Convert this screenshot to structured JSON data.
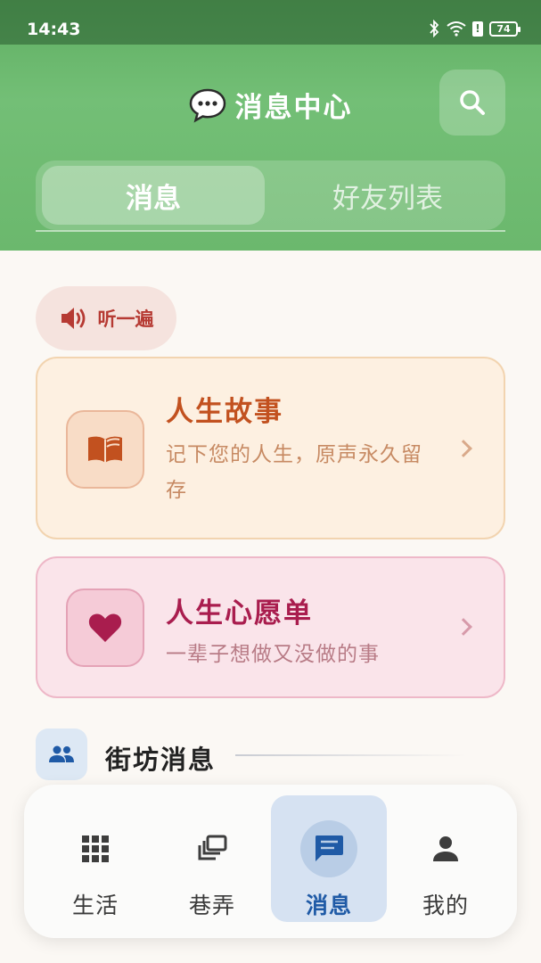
{
  "status_bar": {
    "time": "14:43",
    "battery": "74"
  },
  "header": {
    "title": "消息中心"
  },
  "tabs": [
    {
      "label": "消息",
      "active": true
    },
    {
      "label": "好友列表",
      "active": false
    }
  ],
  "listen_button": {
    "label": "听一遍"
  },
  "cards": [
    {
      "title": "人生故事",
      "description": "记下您的人生，原声永久留存",
      "icon": "book-icon"
    },
    {
      "title": "人生心愿单",
      "description": "一辈子想做又没做的事",
      "icon": "heart-icon"
    }
  ],
  "section": {
    "title": "街坊消息",
    "icon": "people-icon"
  },
  "bottom_nav": [
    {
      "label": "生活",
      "icon": "grid-icon",
      "active": false
    },
    {
      "label": "巷弄",
      "icon": "layers-icon",
      "active": false
    },
    {
      "label": "消息",
      "icon": "chat-icon",
      "active": true
    },
    {
      "label": "我的",
      "icon": "person-icon",
      "active": false
    }
  ],
  "colors": {
    "header_green": "#6bb86d",
    "story_accent": "#c2511f",
    "wish_accent": "#a91d4e",
    "nav_active": "#1f5aa6"
  }
}
